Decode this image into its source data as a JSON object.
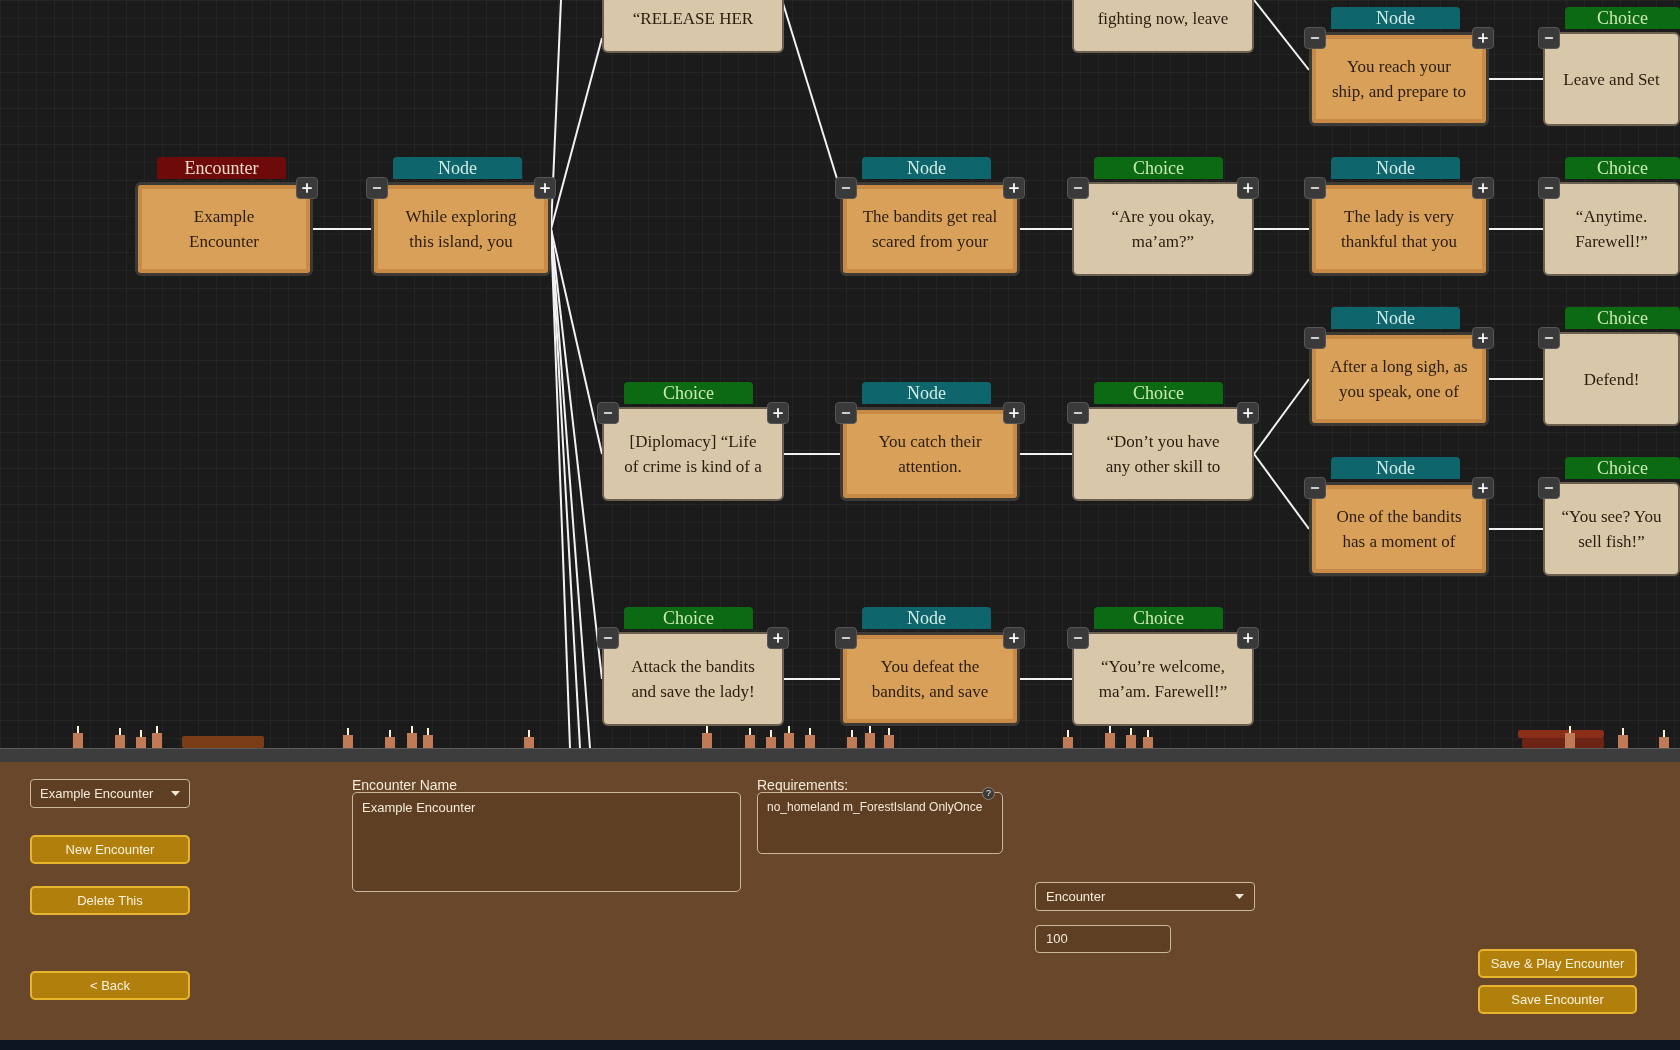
{
  "canvas": {
    "cards": [
      {
        "kind": "encounter",
        "tab": "Encounter",
        "lines": [
          "Example",
          "Encounter"
        ],
        "minus": false,
        "plus": true
      },
      {
        "kind": "node",
        "tab": "Node",
        "lines": [
          "While exploring",
          "this island, you"
        ],
        "minus": true,
        "plus": true
      },
      {
        "kind": "choice",
        "lines": [
          "“RELEASE HER"
        ],
        "minus": false,
        "plus": false
      },
      {
        "kind": "choice",
        "lines": [
          "fighting now, leave"
        ],
        "minus": false,
        "plus": false
      },
      {
        "kind": "node",
        "tab": "Node",
        "lines": [
          "You reach your",
          "ship, and prepare to"
        ],
        "minus": true,
        "plus": true
      },
      {
        "kind": "choice",
        "tab": "Choice",
        "lines": [
          "Leave and Set"
        ],
        "minus": true,
        "plus": false
      },
      {
        "kind": "node",
        "tab": "Node",
        "lines": [
          "The bandits get real",
          "scared from your"
        ],
        "minus": true,
        "plus": true
      },
      {
        "kind": "choice",
        "tab": "Choice",
        "lines": [
          "“Are you okay,",
          "ma’am?”"
        ],
        "minus": true,
        "plus": true
      },
      {
        "kind": "node",
        "tab": "Node",
        "lines": [
          "The lady is very",
          "thankful that you"
        ],
        "minus": true,
        "plus": true
      },
      {
        "kind": "choice",
        "tab": "Choice",
        "lines": [
          "“Anytime.",
          "Farewell!”"
        ],
        "minus": true,
        "plus": false
      },
      {
        "kind": "node",
        "tab": "Node",
        "lines": [
          "After a long sigh, as",
          "you speak, one of"
        ],
        "minus": true,
        "plus": true
      },
      {
        "kind": "choice",
        "tab": "Choice",
        "lines": [
          "Defend!"
        ],
        "minus": true,
        "plus": false
      },
      {
        "kind": "choice",
        "tab": "Choice",
        "lines": [
          "[Diplomacy] “Life",
          "of crime is kind of a"
        ],
        "minus": true,
        "plus": true
      },
      {
        "kind": "node",
        "tab": "Node",
        "lines": [
          "You catch their",
          "attention."
        ],
        "minus": true,
        "plus": true
      },
      {
        "kind": "choice",
        "tab": "Choice",
        "lines": [
          "“Don’t you have",
          "any other skill to"
        ],
        "minus": true,
        "plus": true
      },
      {
        "kind": "node",
        "tab": "Node",
        "lines": [
          "One of the bandits",
          "has a moment of"
        ],
        "minus": true,
        "plus": true
      },
      {
        "kind": "choice",
        "tab": "Choice",
        "lines": [
          "“You see? You",
          "sell fish!”"
        ],
        "minus": true,
        "plus": false
      },
      {
        "kind": "choice",
        "tab": "Choice",
        "lines": [
          "Attack the bandits",
          "and save the lady!"
        ],
        "minus": true,
        "plus": true
      },
      {
        "kind": "node",
        "tab": "Node",
        "lines": [
          "You defeat the",
          "bandits, and save"
        ],
        "minus": true,
        "plus": true
      },
      {
        "kind": "choice",
        "tab": "Choice",
        "lines": [
          "“You’re welcome,",
          "ma’am. Farewell!”"
        ],
        "minus": true,
        "plus": true
      }
    ]
  },
  "panel": {
    "encounter_select": {
      "value": "Example Encounter"
    },
    "left_buttons": [
      "New Encounter",
      "Delete This",
      "< Back"
    ],
    "name_field": {
      "label": "Encounter Name",
      "value": "Example Encounter"
    },
    "requirements_field": {
      "label": "Requirements:",
      "value": "no_homeland m_ForestIsland OnlyOnce",
      "help": "?"
    },
    "type_select": {
      "value": "Encounter"
    },
    "number_field": {
      "value": "100"
    },
    "right_buttons": [
      "Save & Play Encounter",
      "Save Encounter"
    ]
  }
}
